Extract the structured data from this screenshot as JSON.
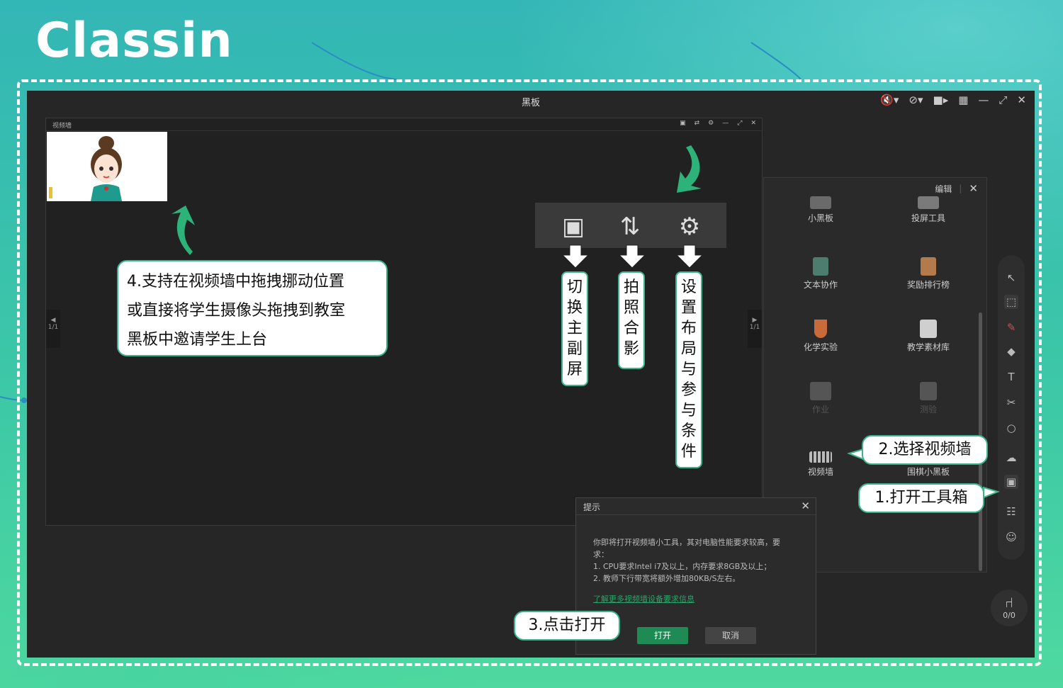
{
  "logo": "Classin",
  "window": {
    "title": "黑板"
  },
  "video_wall": {
    "title": "视频墙",
    "pager_left": "1/1",
    "pager_right": "1/1"
  },
  "popup_labels": [
    "切换主副屏",
    "拍照合影",
    "设置布局与参与条件"
  ],
  "toolbox": {
    "edit_label": "编辑",
    "items": [
      {
        "label": "小黑板"
      },
      {
        "label": "投屏工具"
      },
      {
        "label": "文本协作"
      },
      {
        "label": "奖励排行榜"
      },
      {
        "label": "化学实验"
      },
      {
        "label": "教学素材库"
      },
      {
        "label": "作业"
      },
      {
        "label": "测验"
      },
      {
        "label": "视频墙"
      },
      {
        "label": "围棋小黑板"
      }
    ]
  },
  "seat_count": "0/0",
  "dialog": {
    "title": "提示",
    "line1": "你即将打开视频墙小工具，其对电脑性能要求较高，要",
    "line2": "求：",
    "line3": "1. CPU要求Intel i7及以上，内存要求8GB及以上；",
    "line4": "2. 教师下行带宽将额外增加80KB/S左右。",
    "link": "了解更多视频墙设备要求信息",
    "open": "打开",
    "cancel": "取消"
  },
  "callouts": {
    "step1": "1.打开工具箱",
    "step2": "2.选择视频墙",
    "step3": "3.点击打开",
    "step4_l1": "4.支持在视频墙中拖拽挪动位置",
    "step4_l2": "或直接将学生摄像头拖拽到教室",
    "step4_l3": "黑板中邀请学生上台"
  },
  "colors": {
    "accent": "#3bb587",
    "button": "#1e8a54",
    "app_bg": "#262626"
  }
}
